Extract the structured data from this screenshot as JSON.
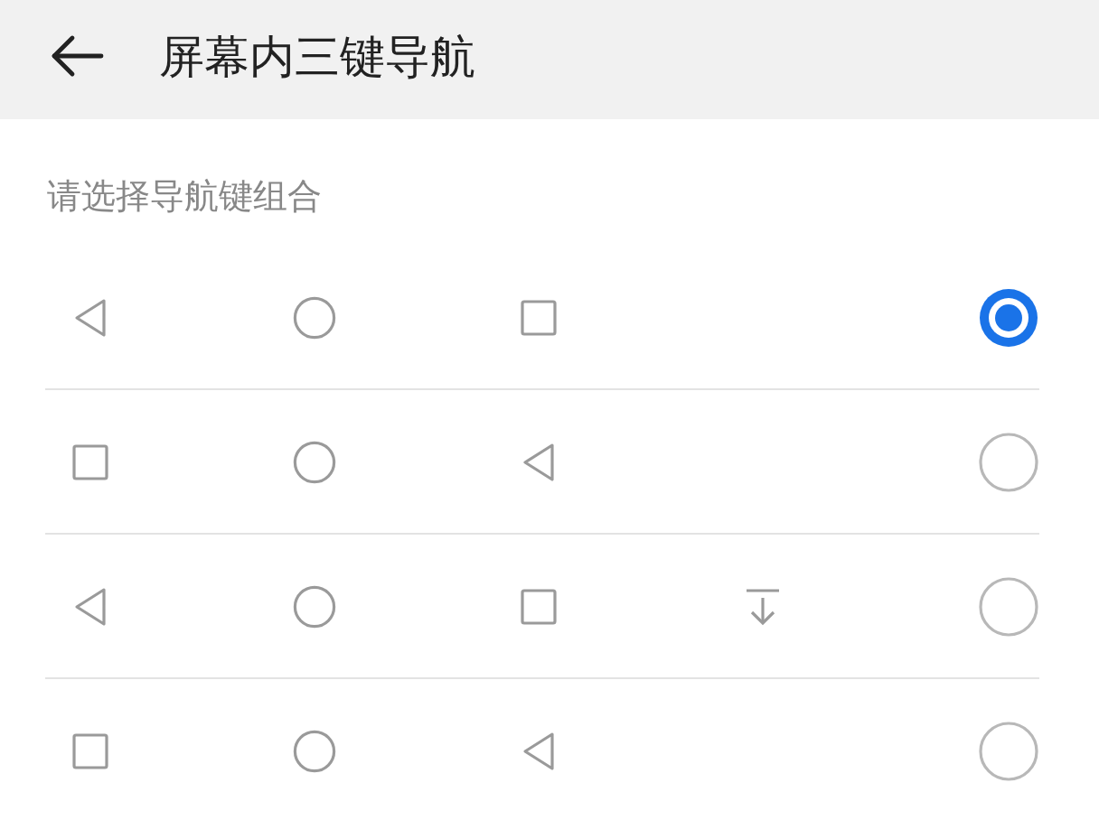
{
  "header": {
    "back_icon": true,
    "title": "屏幕内三键导航"
  },
  "subtitle": "请选择导航键组合",
  "options": [
    {
      "keys": [
        {
          "kind": "back"
        },
        {
          "kind": "home"
        },
        {
          "kind": "recent"
        }
      ],
      "selected": true
    },
    {
      "keys": [
        {
          "kind": "recent"
        },
        {
          "kind": "home"
        },
        {
          "kind": "back"
        }
      ],
      "selected": false
    },
    {
      "keys": [
        {
          "kind": "back"
        },
        {
          "kind": "home"
        },
        {
          "kind": "recent"
        },
        {
          "kind": "notify"
        }
      ],
      "selected": false
    },
    {
      "keys": [
        {
          "kind": "recent"
        },
        {
          "kind": "home"
        },
        {
          "kind": "back"
        }
      ],
      "selected": false
    }
  ]
}
